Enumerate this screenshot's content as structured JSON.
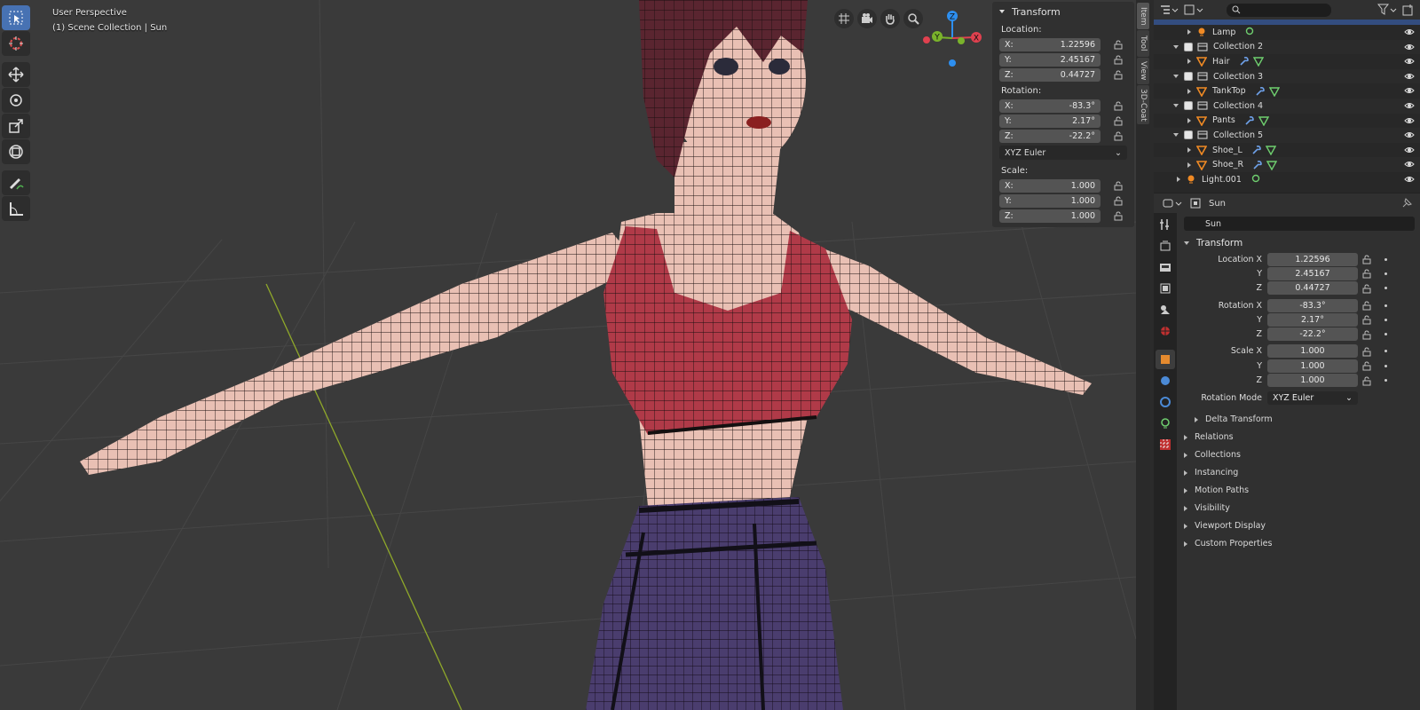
{
  "viewport": {
    "perspective": "User Perspective",
    "collection": "(1) Scene Collection | Sun"
  },
  "toolbar": {
    "tools": [
      "select-box-icon",
      "cursor-icon",
      "move-icon",
      "rotate-icon",
      "scale-icon",
      "transform-icon",
      "annotate-icon",
      "measure-icon"
    ]
  },
  "gizmo": {
    "x_label": "X",
    "y_label": "Y",
    "z_label": "Z",
    "colors": {
      "x": "#e0414f",
      "y": "#7ab32b",
      "z": "#2d8ff0"
    }
  },
  "npanel": {
    "title": "Transform",
    "location_label": "Location:",
    "location": [
      {
        "axis": "X:",
        "value": "1.22596"
      },
      {
        "axis": "Y:",
        "value": "2.45167"
      },
      {
        "axis": "Z:",
        "value": "0.44727"
      }
    ],
    "rotation_label": "Rotation:",
    "rotation": [
      {
        "axis": "X:",
        "value": "-83.3°"
      },
      {
        "axis": "Y:",
        "value": "2.17°"
      },
      {
        "axis": "Z:",
        "value": "-22.2°"
      }
    ],
    "rotation_mode": "XYZ Euler",
    "scale_label": "Scale:",
    "scale": [
      {
        "axis": "X:",
        "value": "1.000"
      },
      {
        "axis": "Y:",
        "value": "1.000"
      },
      {
        "axis": "Z:",
        "value": "1.000"
      }
    ]
  },
  "sidetabs": [
    "Item",
    "Tool",
    "View",
    "3D-Coat"
  ],
  "outliner": {
    "rows": [
      {
        "name": "Lamp",
        "type": "light",
        "indent": 1
      },
      {
        "name": "Collection 2",
        "type": "collection",
        "indent": 0
      },
      {
        "name": "Hair",
        "type": "mesh",
        "indent": 1
      },
      {
        "name": "Collection 3",
        "type": "collection",
        "indent": 0
      },
      {
        "name": "TankTop",
        "type": "mesh",
        "indent": 1
      },
      {
        "name": "Collection 4",
        "type": "collection",
        "indent": 0
      },
      {
        "name": "Pants",
        "type": "mesh",
        "indent": 1
      },
      {
        "name": "Collection 5",
        "type": "collection",
        "indent": 0
      },
      {
        "name": "Shoe_L",
        "type": "mesh",
        "indent": 1
      },
      {
        "name": "Shoe_R",
        "type": "mesh",
        "indent": 1
      },
      {
        "name": "Light.001",
        "type": "light",
        "indent": -1
      }
    ]
  },
  "properties": {
    "header_object": "Sun",
    "name_field": "Sun",
    "transform_title": "Transform",
    "rows": [
      {
        "label": "Location X",
        "value": "1.22596"
      },
      {
        "label": "Y",
        "value": "2.45167"
      },
      {
        "label": "Z",
        "value": "0.44727"
      },
      {
        "label": "Rotation X",
        "value": "-83.3°"
      },
      {
        "label": "Y",
        "value": "2.17°"
      },
      {
        "label": "Z",
        "value": "-22.2°"
      },
      {
        "label": "Scale X",
        "value": "1.000"
      },
      {
        "label": "Y",
        "value": "1.000"
      },
      {
        "label": "Z",
        "value": "1.000"
      }
    ],
    "rotation_mode_label": "Rotation Mode",
    "rotation_mode": "XYZ Euler",
    "delta_transform": "Delta Transform",
    "sections": [
      "Relations",
      "Collections",
      "Instancing",
      "Motion Paths",
      "Visibility",
      "Viewport Display",
      "Custom Properties"
    ]
  }
}
